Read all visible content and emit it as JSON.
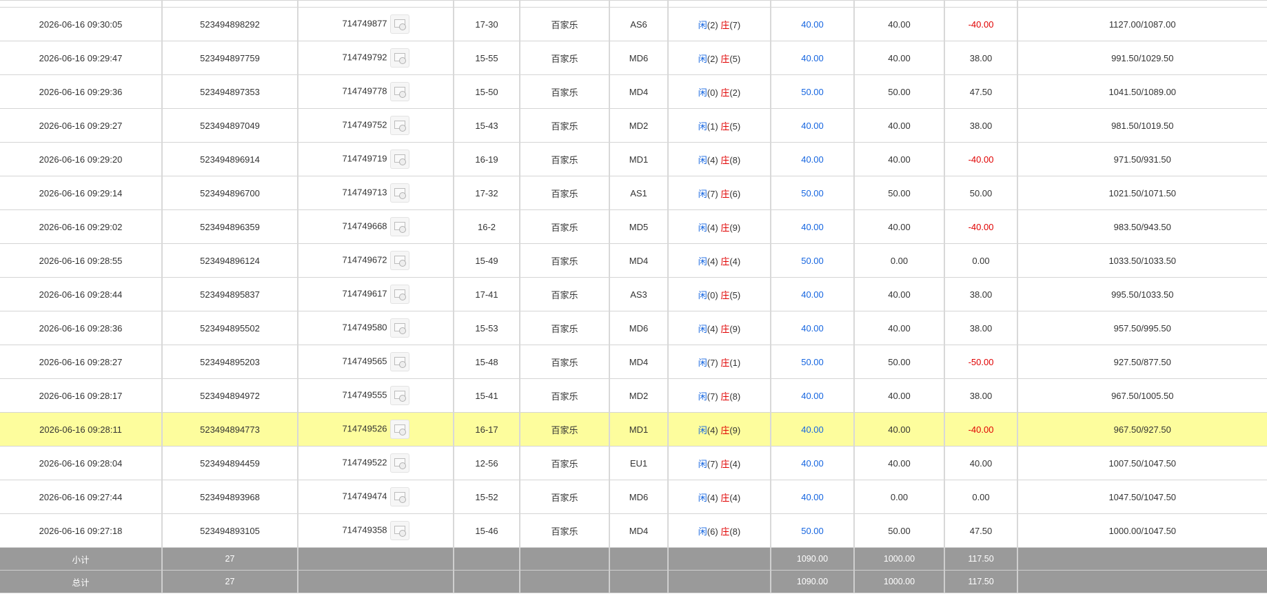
{
  "colors": {
    "player": "#1565e0",
    "banker": "#e00000",
    "highlight_row": "#fdfd9d",
    "summary_bg": "#9a9a9a",
    "negative": "#e00000",
    "bet_amount": "#1565e0"
  },
  "labels": {
    "player": "闲",
    "banker": "庄",
    "ticket_icon": "ticket-image-icon"
  },
  "rows": [
    {
      "time": "2026-06-16 09:30:05",
      "order_id": "523494898292",
      "game_id": "714749877",
      "round": "17-30",
      "game": "百家乐",
      "table": "AS6",
      "player_pts": "(2)",
      "banker_pts": "(7)",
      "bet": "40.00",
      "valid_bet": "40.00",
      "win_loss": "-40.00",
      "negative": true,
      "balance": "1127.00/1087.00"
    },
    {
      "time": "2026-06-16 09:29:47",
      "order_id": "523494897759",
      "game_id": "714749792",
      "round": "15-55",
      "game": "百家乐",
      "table": "MD6",
      "player_pts": "(2)",
      "banker_pts": "(5)",
      "bet": "40.00",
      "valid_bet": "40.00",
      "win_loss": "38.00",
      "negative": false,
      "balance": "991.50/1029.50"
    },
    {
      "time": "2026-06-16 09:29:36",
      "order_id": "523494897353",
      "game_id": "714749778",
      "round": "15-50",
      "game": "百家乐",
      "table": "MD4",
      "player_pts": "(0)",
      "banker_pts": "(2)",
      "bet": "50.00",
      "valid_bet": "50.00",
      "win_loss": "47.50",
      "negative": false,
      "balance": "1041.50/1089.00"
    },
    {
      "time": "2026-06-16 09:29:27",
      "order_id": "523494897049",
      "game_id": "714749752",
      "round": "15-43",
      "game": "百家乐",
      "table": "MD2",
      "player_pts": "(1)",
      "banker_pts": "(5)",
      "bet": "40.00",
      "valid_bet": "40.00",
      "win_loss": "38.00",
      "negative": false,
      "balance": "981.50/1019.50"
    },
    {
      "time": "2026-06-16 09:29:20",
      "order_id": "523494896914",
      "game_id": "714749719",
      "round": "16-19",
      "game": "百家乐",
      "table": "MD1",
      "player_pts": "(4)",
      "banker_pts": "(8)",
      "bet": "40.00",
      "valid_bet": "40.00",
      "win_loss": "-40.00",
      "negative": true,
      "balance": "971.50/931.50"
    },
    {
      "time": "2026-06-16 09:29:14",
      "order_id": "523494896700",
      "game_id": "714749713",
      "round": "17-32",
      "game": "百家乐",
      "table": "AS1",
      "player_pts": "(7)",
      "banker_pts": "(6)",
      "bet": "50.00",
      "valid_bet": "50.00",
      "win_loss": "50.00",
      "negative": false,
      "balance": "1021.50/1071.50"
    },
    {
      "time": "2026-06-16 09:29:02",
      "order_id": "523494896359",
      "game_id": "714749668",
      "round": "16-2",
      "game": "百家乐",
      "table": "MD5",
      "player_pts": "(4)",
      "banker_pts": "(9)",
      "bet": "40.00",
      "valid_bet": "40.00",
      "win_loss": "-40.00",
      "negative": true,
      "balance": "983.50/943.50"
    },
    {
      "time": "2026-06-16 09:28:55",
      "order_id": "523494896124",
      "game_id": "714749672",
      "round": "15-49",
      "game": "百家乐",
      "table": "MD4",
      "player_pts": "(4)",
      "banker_pts": "(4)",
      "bet": "50.00",
      "valid_bet": "0.00",
      "win_loss": "0.00",
      "negative": false,
      "balance": "1033.50/1033.50"
    },
    {
      "time": "2026-06-16 09:28:44",
      "order_id": "523494895837",
      "game_id": "714749617",
      "round": "17-41",
      "game": "百家乐",
      "table": "AS3",
      "player_pts": "(0)",
      "banker_pts": "(5)",
      "bet": "40.00",
      "valid_bet": "40.00",
      "win_loss": "38.00",
      "negative": false,
      "balance": "995.50/1033.50"
    },
    {
      "time": "2026-06-16 09:28:36",
      "order_id": "523494895502",
      "game_id": "714749580",
      "round": "15-53",
      "game": "百家乐",
      "table": "MD6",
      "player_pts": "(4)",
      "banker_pts": "(9)",
      "bet": "40.00",
      "valid_bet": "40.00",
      "win_loss": "38.00",
      "negative": false,
      "balance": "957.50/995.50"
    },
    {
      "time": "2026-06-16 09:28:27",
      "order_id": "523494895203",
      "game_id": "714749565",
      "round": "15-48",
      "game": "百家乐",
      "table": "MD4",
      "player_pts": "(7)",
      "banker_pts": "(1)",
      "bet": "50.00",
      "valid_bet": "50.00",
      "win_loss": "-50.00",
      "negative": true,
      "balance": "927.50/877.50"
    },
    {
      "time": "2026-06-16 09:28:17",
      "order_id": "523494894972",
      "game_id": "714749555",
      "round": "15-41",
      "game": "百家乐",
      "table": "MD2",
      "player_pts": "(7)",
      "banker_pts": "(8)",
      "bet": "40.00",
      "valid_bet": "40.00",
      "win_loss": "38.00",
      "negative": false,
      "balance": "967.50/1005.50"
    },
    {
      "time": "2026-06-16 09:28:11",
      "order_id": "523494894773",
      "game_id": "714749526",
      "round": "16-17",
      "game": "百家乐",
      "table": "MD1",
      "player_pts": "(4)",
      "banker_pts": "(9)",
      "bet": "40.00",
      "valid_bet": "40.00",
      "win_loss": "-40.00",
      "negative": true,
      "balance": "967.50/927.50",
      "highlighted": true
    },
    {
      "time": "2026-06-16 09:28:04",
      "order_id": "523494894459",
      "game_id": "714749522",
      "round": "12-56",
      "game": "百家乐",
      "table": "EU1",
      "player_pts": "(7)",
      "banker_pts": "(4)",
      "bet": "40.00",
      "valid_bet": "40.00",
      "win_loss": "40.00",
      "negative": false,
      "balance": "1007.50/1047.50"
    },
    {
      "time": "2026-06-16 09:27:44",
      "order_id": "523494893968",
      "game_id": "714749474",
      "round": "15-52",
      "game": "百家乐",
      "table": "MD6",
      "player_pts": "(4)",
      "banker_pts": "(4)",
      "bet": "40.00",
      "valid_bet": "0.00",
      "win_loss": "0.00",
      "negative": false,
      "balance": "1047.50/1047.50"
    },
    {
      "time": "2026-06-16 09:27:18",
      "order_id": "523494893105",
      "game_id": "714749358",
      "round": "15-46",
      "game": "百家乐",
      "table": "MD4",
      "player_pts": "(6)",
      "banker_pts": "(8)",
      "bet": "50.00",
      "valid_bet": "50.00",
      "win_loss": "47.50",
      "negative": false,
      "balance": "1000.00/1047.50"
    }
  ],
  "subtotal": {
    "label": "小计",
    "count": "27",
    "bet": "1090.00",
    "valid_bet": "1000.00",
    "win_loss": "117.50"
  },
  "total": {
    "label": "总计",
    "count": "27",
    "bet": "1090.00",
    "valid_bet": "1000.00",
    "win_loss": "117.50"
  }
}
